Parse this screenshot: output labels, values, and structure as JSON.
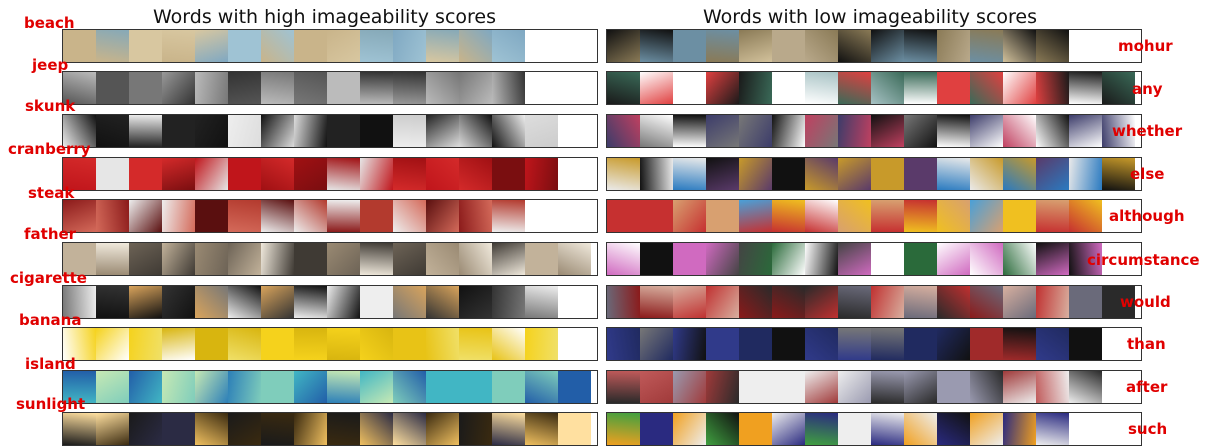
{
  "left_panel": {
    "title": "Words with high imageability scores",
    "words": [
      "beach",
      "jeep",
      "skunk",
      "cranberry",
      "steak",
      "father",
      "cigarette",
      "banana",
      "island",
      "sunlight"
    ]
  },
  "right_panel": {
    "title": "Words with low imageability scores",
    "words": [
      "mohur",
      "any",
      "whether",
      "else",
      "although",
      "circumstance",
      "would",
      "than",
      "after",
      "such"
    ]
  },
  "colors": {
    "label": "#e00000",
    "strip_border": "#333333"
  }
}
